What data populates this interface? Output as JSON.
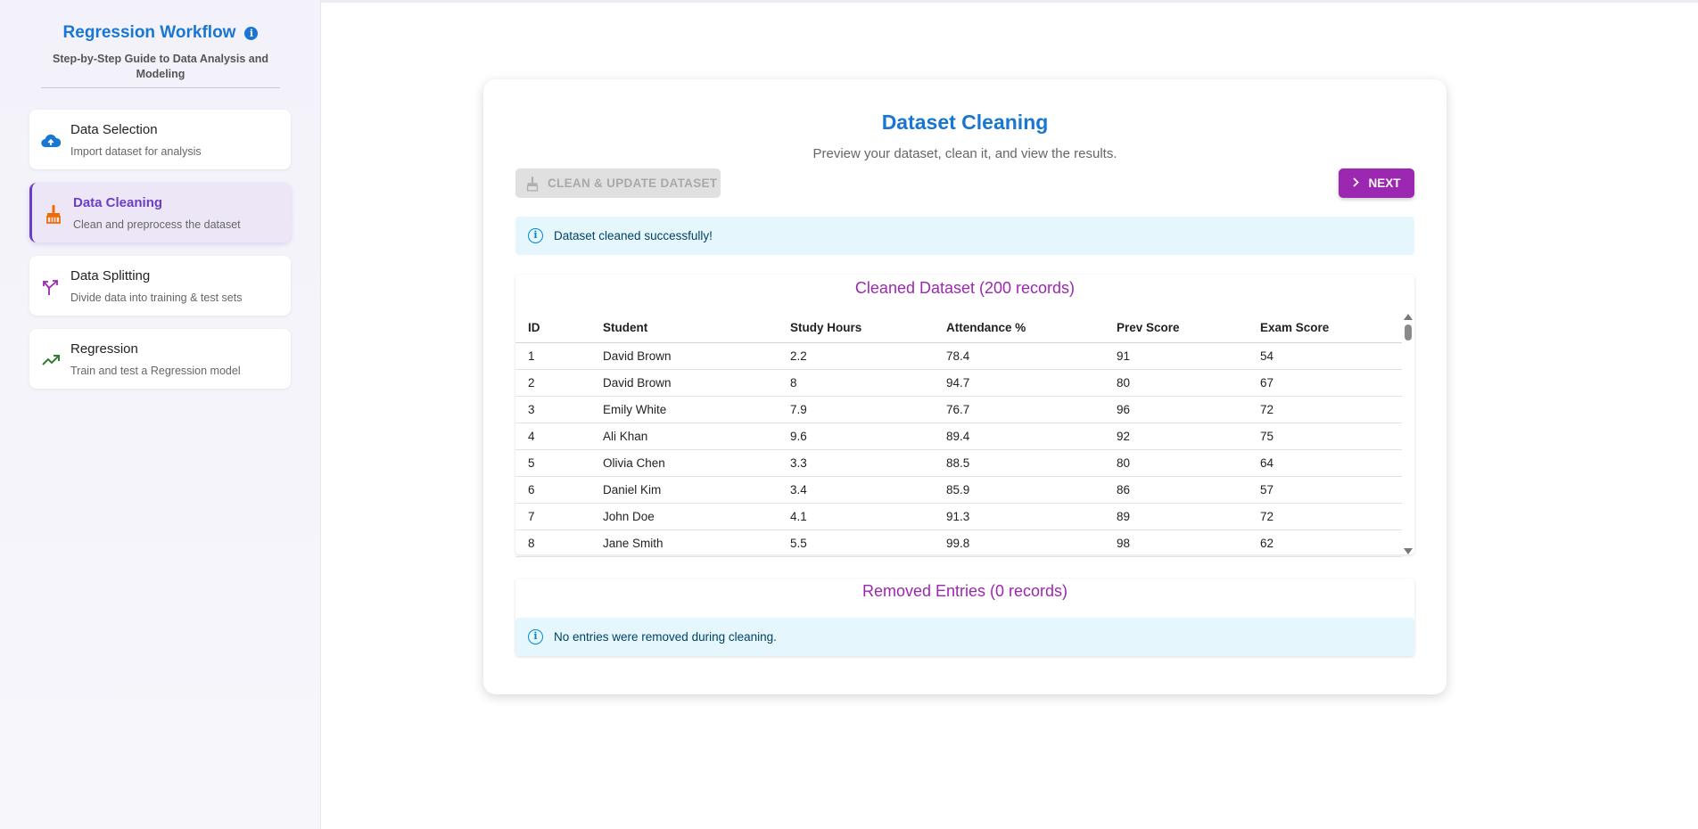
{
  "sidebar": {
    "title": "Regression Workflow",
    "subtitle": "Step-by-Step Guide to Data Analysis and Modeling",
    "steps": [
      {
        "title": "Data Selection",
        "desc": "Import dataset for analysis",
        "icon": "cloud-upload-icon"
      },
      {
        "title": "Data Cleaning",
        "desc": "Clean and preprocess the dataset",
        "icon": "broom-icon",
        "active": true
      },
      {
        "title": "Data Splitting",
        "desc": "Divide data into training & test sets",
        "icon": "split-arrows-icon"
      },
      {
        "title": "Regression",
        "desc": "Train and test a Regression model",
        "icon": "trending-up-icon"
      }
    ]
  },
  "main": {
    "title": "Dataset Cleaning",
    "subtitle": "Preview your dataset, clean it, and view the results.",
    "clean_button": "CLEAN & UPDATE DATASET",
    "next_button": "NEXT",
    "success_alert": "Dataset cleaned successfully!",
    "cleaned": {
      "title": "Cleaned Dataset (200 records)",
      "columns": [
        "ID",
        "Student",
        "Study Hours",
        "Attendance %",
        "Prev Score",
        "Exam Score"
      ],
      "rows": [
        [
          "1",
          "David Brown",
          "2.2",
          "78.4",
          "91",
          "54"
        ],
        [
          "2",
          "David Brown",
          "8",
          "94.7",
          "80",
          "67"
        ],
        [
          "3",
          "Emily White",
          "7.9",
          "76.7",
          "96",
          "72"
        ],
        [
          "4",
          "Ali Khan",
          "9.6",
          "89.4",
          "92",
          "75"
        ],
        [
          "5",
          "Olivia Chen",
          "3.3",
          "88.5",
          "80",
          "64"
        ],
        [
          "6",
          "Daniel Kim",
          "3.4",
          "85.9",
          "86",
          "57"
        ],
        [
          "7",
          "John Doe",
          "4.1",
          "91.3",
          "89",
          "72"
        ],
        [
          "8",
          "Jane Smith",
          "5.5",
          "99.8",
          "98",
          "62"
        ]
      ]
    },
    "removed": {
      "title": "Removed Entries (0 records)",
      "message": "No entries were removed during cleaning."
    }
  },
  "colors": {
    "primary": "#1976d2",
    "accent": "#9c27b0",
    "active_step": "#6a3ec5",
    "info_bg": "#e5f6fd"
  }
}
